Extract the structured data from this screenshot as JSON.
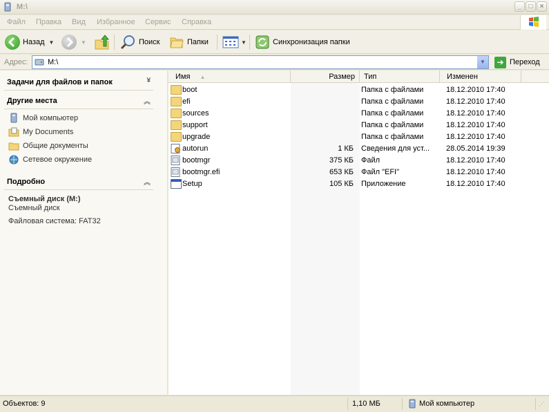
{
  "window": {
    "title": "M:\\"
  },
  "menu": [
    "Файл",
    "Правка",
    "Вид",
    "Избранное",
    "Сервис",
    "Справка"
  ],
  "toolbar": {
    "back_label": "Назад",
    "search_label": "Поиск",
    "folders_label": "Папки",
    "sync_label": "Синхронизация папки"
  },
  "address": {
    "label": "Адрес:",
    "value": "M:\\",
    "go_label": "Переход"
  },
  "taskpane": {
    "tasks_title": "Задачи для файлов и папок",
    "places_title": "Другие места",
    "places": [
      {
        "label": "Мой компьютер",
        "icon": "my-computer-icon"
      },
      {
        "label": "My Documents",
        "icon": "my-documents-icon"
      },
      {
        "label": "Общие документы",
        "icon": "shared-documents-icon"
      },
      {
        "label": "Сетевое окружение",
        "icon": "network-places-icon"
      }
    ],
    "details_title": "Подробно",
    "details": {
      "name": "Съемный диск (M:)",
      "type": "Съемный диск",
      "fs": "Файловая система: FAT32"
    }
  },
  "columns": {
    "name": "Имя",
    "size": "Размер",
    "type": "Тип",
    "modified": "Изменен"
  },
  "files": [
    {
      "name": "boot",
      "size": "",
      "type": "Папка с файлами",
      "modified": "18.12.2010 17:40",
      "kind": "folder"
    },
    {
      "name": "efi",
      "size": "",
      "type": "Папка с файлами",
      "modified": "18.12.2010 17:40",
      "kind": "folder"
    },
    {
      "name": "sources",
      "size": "",
      "type": "Папка с файлами",
      "modified": "18.12.2010 17:40",
      "kind": "folder"
    },
    {
      "name": "support",
      "size": "",
      "type": "Папка с файлами",
      "modified": "18.12.2010 17:40",
      "kind": "folder"
    },
    {
      "name": "upgrade",
      "size": "",
      "type": "Папка с файлами",
      "modified": "18.12.2010 17:40",
      "kind": "folder"
    },
    {
      "name": "autorun",
      "size": "1 КБ",
      "type": "Сведения для уст...",
      "modified": "28.05.2014 19:39",
      "kind": "autorun"
    },
    {
      "name": "bootmgr",
      "size": "375 КБ",
      "type": "Файл",
      "modified": "18.12.2010 17:40",
      "kind": "file"
    },
    {
      "name": "bootmgr.efi",
      "size": "653 КБ",
      "type": "Файл \"EFI\"",
      "modified": "18.12.2010 17:40",
      "kind": "file"
    },
    {
      "name": "Setup",
      "size": "105 КБ",
      "type": "Приложение",
      "modified": "18.12.2010 17:40",
      "kind": "app"
    }
  ],
  "status": {
    "objects": "Объектов: 9",
    "size": "1,10 МБ",
    "location": "Мой компьютер"
  }
}
